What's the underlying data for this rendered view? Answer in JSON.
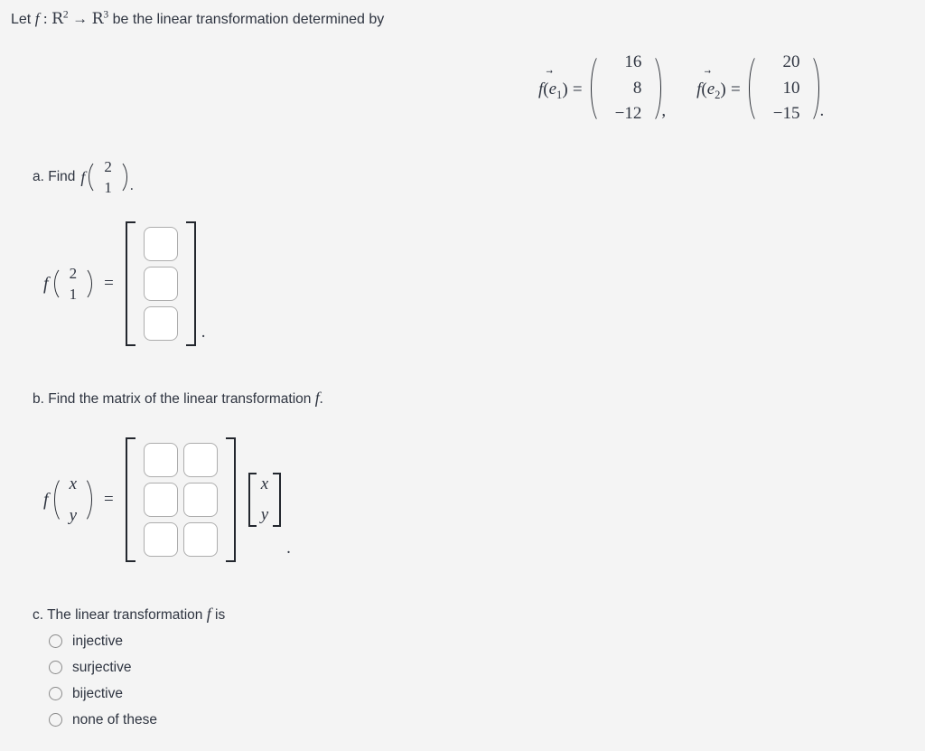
{
  "page": {
    "background_color": "#f4f4f4",
    "text_color": "#2e3440",
    "box_border_color": "#adadad",
    "bracket_color": "#23272e"
  },
  "intro": {
    "lead": "Let",
    "function_symbol": "f",
    "colon": ":",
    "domain_symbol": "R",
    "domain_exponent": "2",
    "arrow": "→",
    "codomain_symbol": "R",
    "codomain_exponent": "3",
    "tail": "be the linear transformation determined by"
  },
  "basis_equations": {
    "first": {
      "label_function": "f",
      "label_open": "(",
      "label_vector": "e",
      "label_subscript": "1",
      "label_close": ")",
      "equals": "=",
      "entries": [
        "16",
        "8",
        "−12"
      ],
      "trailing_punct": ","
    },
    "second": {
      "label_function": "f",
      "label_open": "(",
      "label_vector": "e",
      "label_subscript": "2",
      "label_close": ")",
      "equals": "=",
      "entries": [
        "20",
        "10",
        "−15"
      ],
      "trailing_punct": "."
    },
    "vector_arrow": "⃗"
  },
  "part_a": {
    "prompt_prefix": "a. Find",
    "prompt_function": "f",
    "prompt_vector": [
      "2",
      "1"
    ],
    "prompt_suffix": ".",
    "answer": {
      "function_symbol": "f",
      "input_vector": [
        "2",
        "1"
      ],
      "equals": "=",
      "boxes": [
        {
          "name": "answer-box-a-row1",
          "value": "",
          "placeholder": ""
        },
        {
          "name": "answer-box-a-row2",
          "value": "",
          "placeholder": ""
        },
        {
          "name": "answer-box-a-row3",
          "value": "",
          "placeholder": ""
        }
      ],
      "trailing_punct": "."
    }
  },
  "part_b": {
    "prompt_prefix": "b. Find the matrix of the linear transformation",
    "prompt_function": "f",
    "prompt_suffix": ".",
    "answer": {
      "function_symbol": "f",
      "input_vector": [
        "x",
        "y"
      ],
      "equals": "=",
      "matrix_rows": [
        [
          {
            "name": "matrix-box-r1c1",
            "value": ""
          },
          {
            "name": "matrix-box-r1c2",
            "value": ""
          }
        ],
        [
          {
            "name": "matrix-box-r2c1",
            "value": ""
          },
          {
            "name": "matrix-box-r2c2",
            "value": ""
          }
        ],
        [
          {
            "name": "matrix-box-r3c1",
            "value": ""
          },
          {
            "name": "matrix-box-r3c2",
            "value": ""
          }
        ]
      ],
      "multiplied_vector": [
        "x",
        "y"
      ],
      "trailing_punct": "."
    }
  },
  "part_c": {
    "prompt_prefix": "c. The linear transformation",
    "prompt_function": "f",
    "prompt_suffix": "is",
    "selected_option": null,
    "options": [
      {
        "id": "injective",
        "label": "injective",
        "selected": false
      },
      {
        "id": "surjective",
        "label": "surjective",
        "selected": false
      },
      {
        "id": "bijective",
        "label": "bijective",
        "selected": false
      },
      {
        "id": "none-of-these",
        "label": "none of these",
        "selected": false
      }
    ]
  }
}
